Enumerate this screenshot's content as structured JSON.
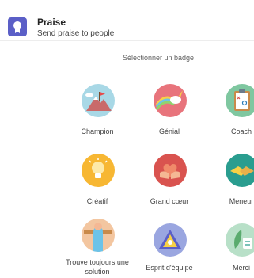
{
  "header": {
    "title": "Praise",
    "subtitle": "Send praise to people",
    "icon": "ribbon-badge-icon",
    "accent": "#5b5fc7"
  },
  "picker": {
    "label": "Sélectionner un badge",
    "badges": [
      {
        "label": "Champion",
        "icon": "mountain-flag-icon",
        "color": "#a8d8e6"
      },
      {
        "label": "Génial",
        "icon": "unicorn-rainbow-icon",
        "color": "#e8747c"
      },
      {
        "label": "Coach",
        "icon": "clipboard-icon",
        "color": "#7fc7a0"
      },
      {
        "label": "Créatif",
        "icon": "lightbulb-icon",
        "color": "#f7b733"
      },
      {
        "label": "Grand cœur",
        "icon": "heart-hands-icon",
        "color": "#d9534f"
      },
      {
        "label": "Meneur",
        "icon": "handshake-icon",
        "color": "#2a9d8f"
      },
      {
        "label": "Trouve toujours une solution",
        "icon": "hand-raised-icon",
        "color": "#f3c6a0"
      },
      {
        "label": "Esprit d'équipe",
        "icon": "team-triangle-icon",
        "color": "#9aa6e0"
      },
      {
        "label": "Merci",
        "icon": "leaf-thanks-icon",
        "color": "#b8e0c8"
      }
    ]
  }
}
